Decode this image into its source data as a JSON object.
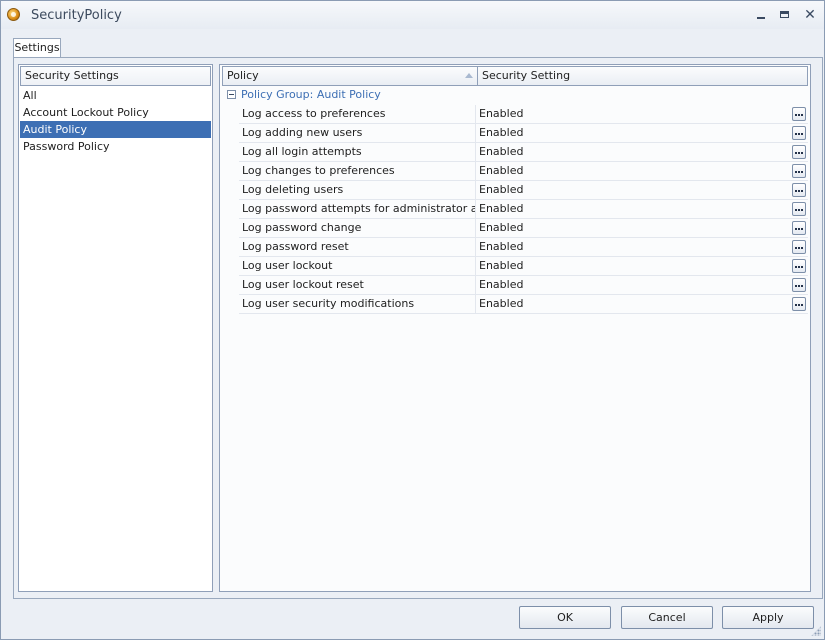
{
  "window": {
    "title": "SecurityPolicy",
    "controls": {
      "minimize": "minimize",
      "maximize": "maximize",
      "close": "✕"
    }
  },
  "tabs": [
    {
      "label": "Settings"
    }
  ],
  "left_panel": {
    "header": "Security Settings",
    "items": [
      {
        "label": "All"
      },
      {
        "label": "Account Lockout Policy"
      },
      {
        "label": "Audit Policy",
        "selected": true
      },
      {
        "label": "Password Policy"
      }
    ]
  },
  "grid": {
    "columns": {
      "policy": "Policy",
      "setting": "Security Setting"
    },
    "group_label": "Policy Group: Audit Policy",
    "rows": [
      {
        "policy": "Log access to preferences",
        "setting": "Enabled"
      },
      {
        "policy": "Log adding new users",
        "setting": "Enabled"
      },
      {
        "policy": "Log all login attempts",
        "setting": "Enabled"
      },
      {
        "policy": "Log changes to preferences",
        "setting": "Enabled"
      },
      {
        "policy": "Log deleting users",
        "setting": "Enabled"
      },
      {
        "policy": "Log password attempts for administrator access",
        "setting": "Enabled"
      },
      {
        "policy": "Log password change",
        "setting": "Enabled"
      },
      {
        "policy": "Log password reset",
        "setting": "Enabled"
      },
      {
        "policy": "Log user lockout",
        "setting": "Enabled"
      },
      {
        "policy": "Log user lockout reset",
        "setting": "Enabled"
      },
      {
        "policy": "Log user security modifications",
        "setting": "Enabled"
      }
    ]
  },
  "buttons": {
    "ok": "OK",
    "cancel": "Cancel",
    "apply": "Apply"
  },
  "colors": {
    "selection": "#3d6fb4",
    "group_text": "#3d6fb4",
    "window_bg": "#ebeff5"
  }
}
